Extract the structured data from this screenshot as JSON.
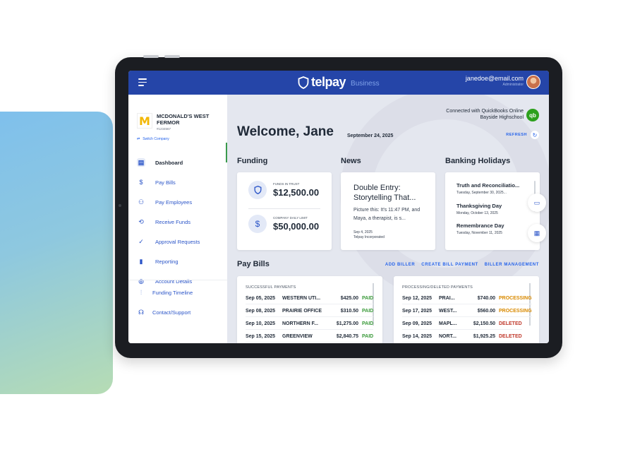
{
  "header": {
    "brand_name": "telpay",
    "brand_sub": "Business",
    "email": "janedoe@email.com",
    "role": "Administrator"
  },
  "company": {
    "name": "MCDONALD'S WEST FERMOR",
    "id": "#1234567",
    "switch_label": "Switch Company"
  },
  "sidebar": {
    "items": [
      {
        "label": "Dashboard",
        "icon": "dashboard-icon"
      },
      {
        "label": "Pay Bills",
        "icon": "dollar-icon"
      },
      {
        "label": "Pay Employees",
        "icon": "people-icon"
      },
      {
        "label": "Receive Funds",
        "icon": "transfer-icon"
      },
      {
        "label": "Approval Requests",
        "icon": "check-circle-icon"
      },
      {
        "label": "Reporting",
        "icon": "bar-chart-icon"
      },
      {
        "label": "Account Details",
        "icon": "account-icon"
      }
    ],
    "bottom": [
      {
        "label": "Funding Timeline",
        "icon": "sliders-icon"
      },
      {
        "label": "Contact/Support",
        "icon": "headset-icon"
      }
    ]
  },
  "main": {
    "welcome": "Welcome, Jane",
    "date": "September 24, 2025",
    "qb_line1": "Connected with QuickBooks Online",
    "qb_line2": "Bayside Highschool",
    "qb_logo": "qb",
    "refresh": "REFRESH"
  },
  "funding": {
    "title": "Funding",
    "trust_label": "FUNDS IN TRUST",
    "trust_value": "$12,500.00",
    "limit_label": "COMPANY DAILY LIMIT",
    "limit_value": "$50,000.00"
  },
  "news": {
    "title": "News",
    "headline": "Double Entry: Storytelling That...",
    "body": "Picture this: It's 11:47 PM, and Maya, a therapist, is s...",
    "date": "Sep 4, 2025",
    "source": "Telpay Incorporated"
  },
  "holidays": {
    "title": "Banking Holidays",
    "items": [
      {
        "name": "Truth and Reconciliatio...",
        "date": "Tuesday, September 30, 2025..."
      },
      {
        "name": "Thanksgiving Day",
        "date": "Monday, October 13, 2025"
      },
      {
        "name": "Remembrance Day",
        "date": "Tuesday, November 11, 2025"
      }
    ]
  },
  "paybills": {
    "title": "Pay Bills",
    "actions": [
      "ADD BILLER",
      "CREATE BILL PAYMENT",
      "BILLER MANAGEMENT"
    ],
    "successful": {
      "heading": "SUCCESSFUL PAYMENTS",
      "rows": [
        {
          "date": "Sep 05, 2025",
          "payee": "WESTERN UTI...",
          "amount": "$425.00",
          "status": "PAID"
        },
        {
          "date": "Sep 08, 2025",
          "payee": "PRAIRIE OFFICE",
          "amount": "$310.50",
          "status": "PAID"
        },
        {
          "date": "Sep 10, 2025",
          "payee": "NORTHERN F...",
          "amount": "$1,275.00",
          "status": "PAID"
        },
        {
          "date": "Sep 15, 2025",
          "payee": "GREENVIEW",
          "amount": "$2,840.75",
          "status": "PAID"
        }
      ]
    },
    "processing": {
      "heading": "PROCESSING/DELETED PAYMENTS",
      "rows": [
        {
          "date": "Sep 12, 2025",
          "payee": "PRAI...",
          "amount": "$740.00",
          "status": "PROCESSING"
        },
        {
          "date": "Sep 17, 2025",
          "payee": "WEST...",
          "amount": "$560.00",
          "status": "PROCESSING"
        },
        {
          "date": "Sep 09, 2025",
          "payee": "MAPL...",
          "amount": "$2,150.50",
          "status": "DELETED"
        },
        {
          "date": "Sep 14, 2025",
          "payee": "NORT...",
          "amount": "$1,925.25",
          "status": "DELETED"
        }
      ]
    }
  },
  "colors": {
    "topbar": "#2545a8",
    "accent": "#2563eb",
    "paid": "#3a9a3a",
    "processing": "#d98a00",
    "deleted": "#c0392b"
  }
}
